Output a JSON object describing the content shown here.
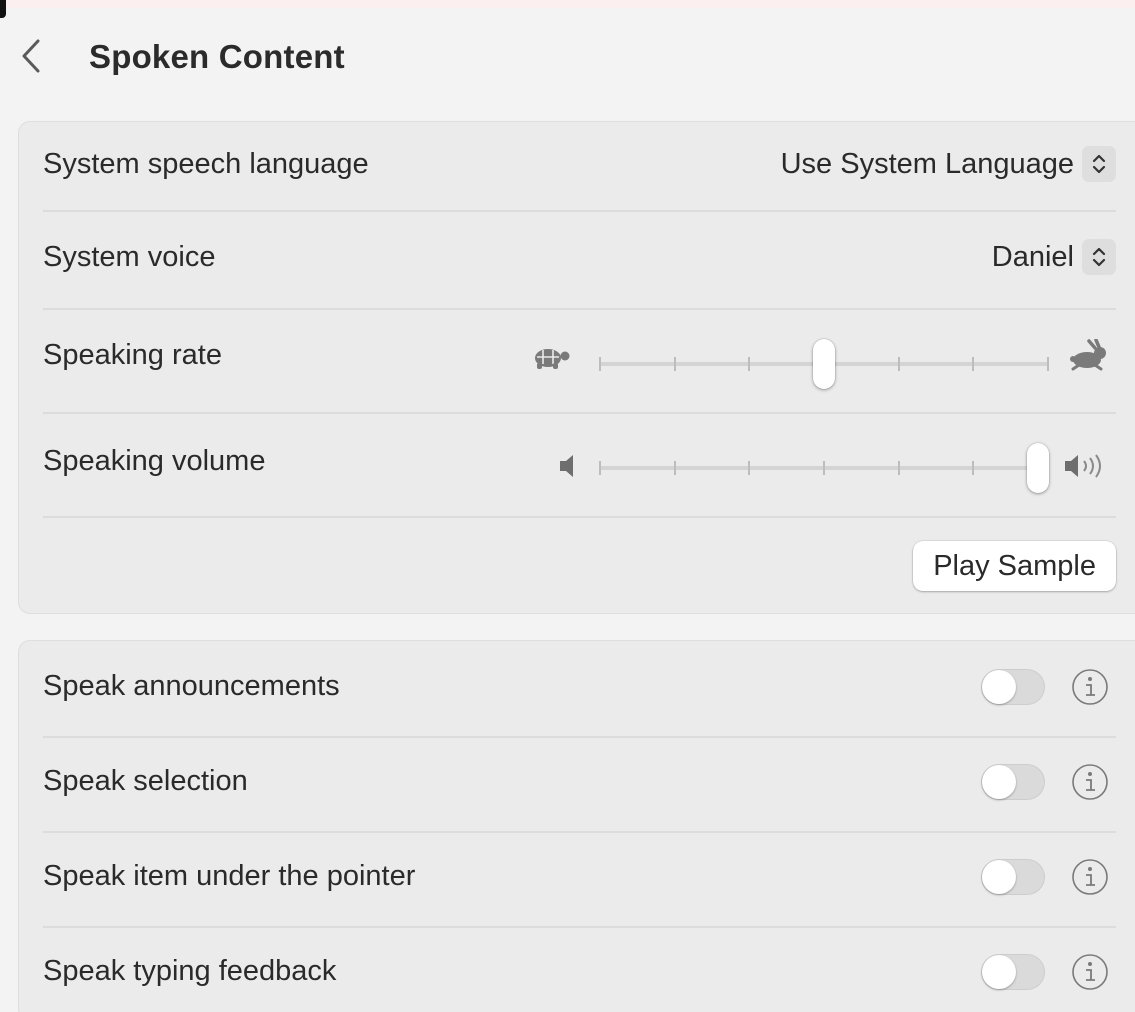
{
  "header": {
    "title": "Spoken Content"
  },
  "speech": {
    "language": {
      "label": "System speech language",
      "value": "Use System Language"
    },
    "voice": {
      "label": "System voice",
      "value": "Daniel"
    },
    "rate": {
      "label": "Speaking rate",
      "position": 0.5,
      "ticks": 7
    },
    "volume": {
      "label": "Speaking volume",
      "position": 1.0,
      "ticks": 7
    },
    "play_sample": "Play Sample"
  },
  "options": [
    {
      "label": "Speak announcements",
      "on": false
    },
    {
      "label": "Speak selection",
      "on": false
    },
    {
      "label": "Speak item under the pointer",
      "on": false
    },
    {
      "label": "Speak typing feedback",
      "on": false
    }
  ],
  "colors": {
    "background": "#f3f3f3",
    "group": "#ebebeb",
    "toggle_off": "#dadada",
    "text": "#2a2a2a"
  },
  "icons": [
    "chevron-left-icon",
    "chevron-updown-icon",
    "turtle-icon",
    "hare-icon",
    "speaker-low-icon",
    "speaker-high-icon",
    "info-icon"
  ]
}
